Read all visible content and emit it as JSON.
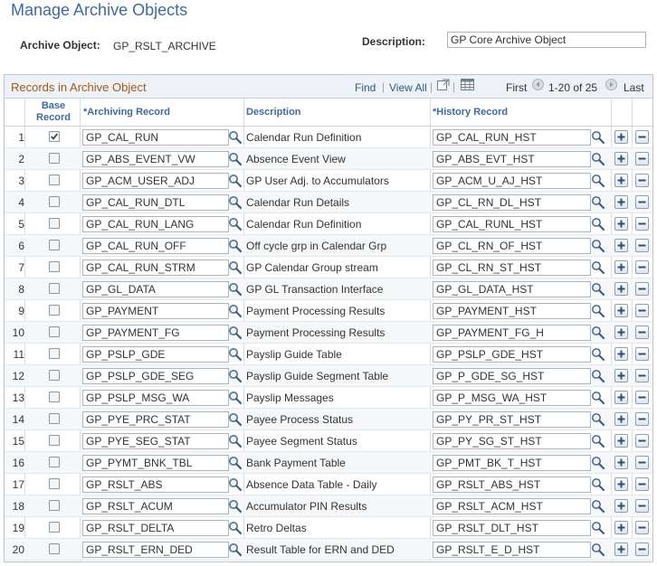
{
  "page": {
    "title": "Manage Archive Objects",
    "archive_object_label": "Archive Object:",
    "archive_object_value": "GP_RSLT_ARCHIVE",
    "description_label": "Description:",
    "description_value": "GP Core Archive Object"
  },
  "grid": {
    "title": "Records in Archive Object",
    "find": "Find",
    "view_all": "View All",
    "first": "First",
    "range": "1-20 of 25",
    "last": "Last",
    "columns": {
      "base_record": "Base Record",
      "archiving_record": "*Archiving Record",
      "description": "Description",
      "history_record": "*History Record"
    },
    "rows": [
      {
        "num": "1",
        "base": true,
        "archiving": "GP_CAL_RUN",
        "description": "Calendar Run Definition",
        "history": "GP_CAL_RUN_HST"
      },
      {
        "num": "2",
        "base": false,
        "archiving": "GP_ABS_EVENT_VW",
        "description": "Absence Event View",
        "history": "GP_ABS_EVT_HST"
      },
      {
        "num": "3",
        "base": false,
        "archiving": "GP_ACM_USER_ADJ",
        "description": "GP User Adj. to Accumulators",
        "history": "GP_ACM_U_AJ_HST"
      },
      {
        "num": "4",
        "base": false,
        "archiving": "GP_CAL_RUN_DTL",
        "description": "Calendar Run Details",
        "history": "GP_CL_RN_DL_HST"
      },
      {
        "num": "5",
        "base": false,
        "archiving": "GP_CAL_RUN_LANG",
        "description": "Calendar Run Definition",
        "history": "GP_CAL_RUNL_HST"
      },
      {
        "num": "6",
        "base": false,
        "archiving": "GP_CAL_RUN_OFF",
        "description": "Off cycle grp in Calendar Grp",
        "history": "GP_CL_RN_OF_HST"
      },
      {
        "num": "7",
        "base": false,
        "archiving": "GP_CAL_RUN_STRM",
        "description": "GP Calendar Group stream",
        "history": "GP_CL_RN_ST_HST"
      },
      {
        "num": "8",
        "base": false,
        "archiving": "GP_GL_DATA",
        "description": "GP GL Transaction Interface",
        "history": "GP_GL_DATA_HST"
      },
      {
        "num": "9",
        "base": false,
        "archiving": "GP_PAYMENT",
        "description": "Payment Processing Results",
        "history": "GP_PAYMENT_HST"
      },
      {
        "num": "10",
        "base": false,
        "archiving": "GP_PAYMENT_FG",
        "description": "Payment Processing Results",
        "history": "GP_PAYMENT_FG_H"
      },
      {
        "num": "11",
        "base": false,
        "archiving": "GP_PSLP_GDE",
        "description": "Payslip Guide Table",
        "history": "GP_PSLP_GDE_HST"
      },
      {
        "num": "12",
        "base": false,
        "archiving": "GP_PSLP_GDE_SEG",
        "description": "Payslip Guide Segment Table",
        "history": "GP_P_GDE_SG_HST"
      },
      {
        "num": "13",
        "base": false,
        "archiving": "GP_PSLP_MSG_WA",
        "description": "Payslip Messages",
        "history": "GP_P_MSG_WA_HST"
      },
      {
        "num": "14",
        "base": false,
        "archiving": "GP_PYE_PRC_STAT",
        "description": "Payee Process Status",
        "history": "GP_PY_PR_ST_HST"
      },
      {
        "num": "15",
        "base": false,
        "archiving": "GP_PYE_SEG_STAT",
        "description": "Payee Segment Status",
        "history": "GP_PY_SG_ST_HST"
      },
      {
        "num": "16",
        "base": false,
        "archiving": "GP_PYMT_BNK_TBL",
        "description": "Bank Payment Table",
        "history": "GP_PMT_BK_T_HST"
      },
      {
        "num": "17",
        "base": false,
        "archiving": "GP_RSLT_ABS",
        "description": "Absence Data Table - Daily",
        "history": "GP_RSLT_ABS_HST"
      },
      {
        "num": "18",
        "base": false,
        "archiving": "GP_RSLT_ACUM",
        "description": "Accumulator PIN Results",
        "history": "GP_RSLT_ACM_HST"
      },
      {
        "num": "19",
        "base": false,
        "archiving": "GP_RSLT_DELTA",
        "description": "Retro Deltas",
        "history": "GP_RSLT_DLT_HST"
      },
      {
        "num": "20",
        "base": false,
        "archiving": "GP_RSLT_ERN_DED",
        "description": "Result Table for ERN and DED",
        "history": "GP_RSLT_E_D_HST"
      }
    ]
  },
  "icons": {
    "lookup": "magnifier-icon",
    "add_row": "plus-icon",
    "delete_row": "minus-icon",
    "zoom": "zoom-grid-icon",
    "download": "download-grid-icon",
    "prev": "previous-arrow-icon",
    "next": "next-arrow-icon"
  },
  "colors": {
    "title": "#3e6a9e",
    "grid_title": "#a2571a",
    "link": "#2c5a8c"
  }
}
